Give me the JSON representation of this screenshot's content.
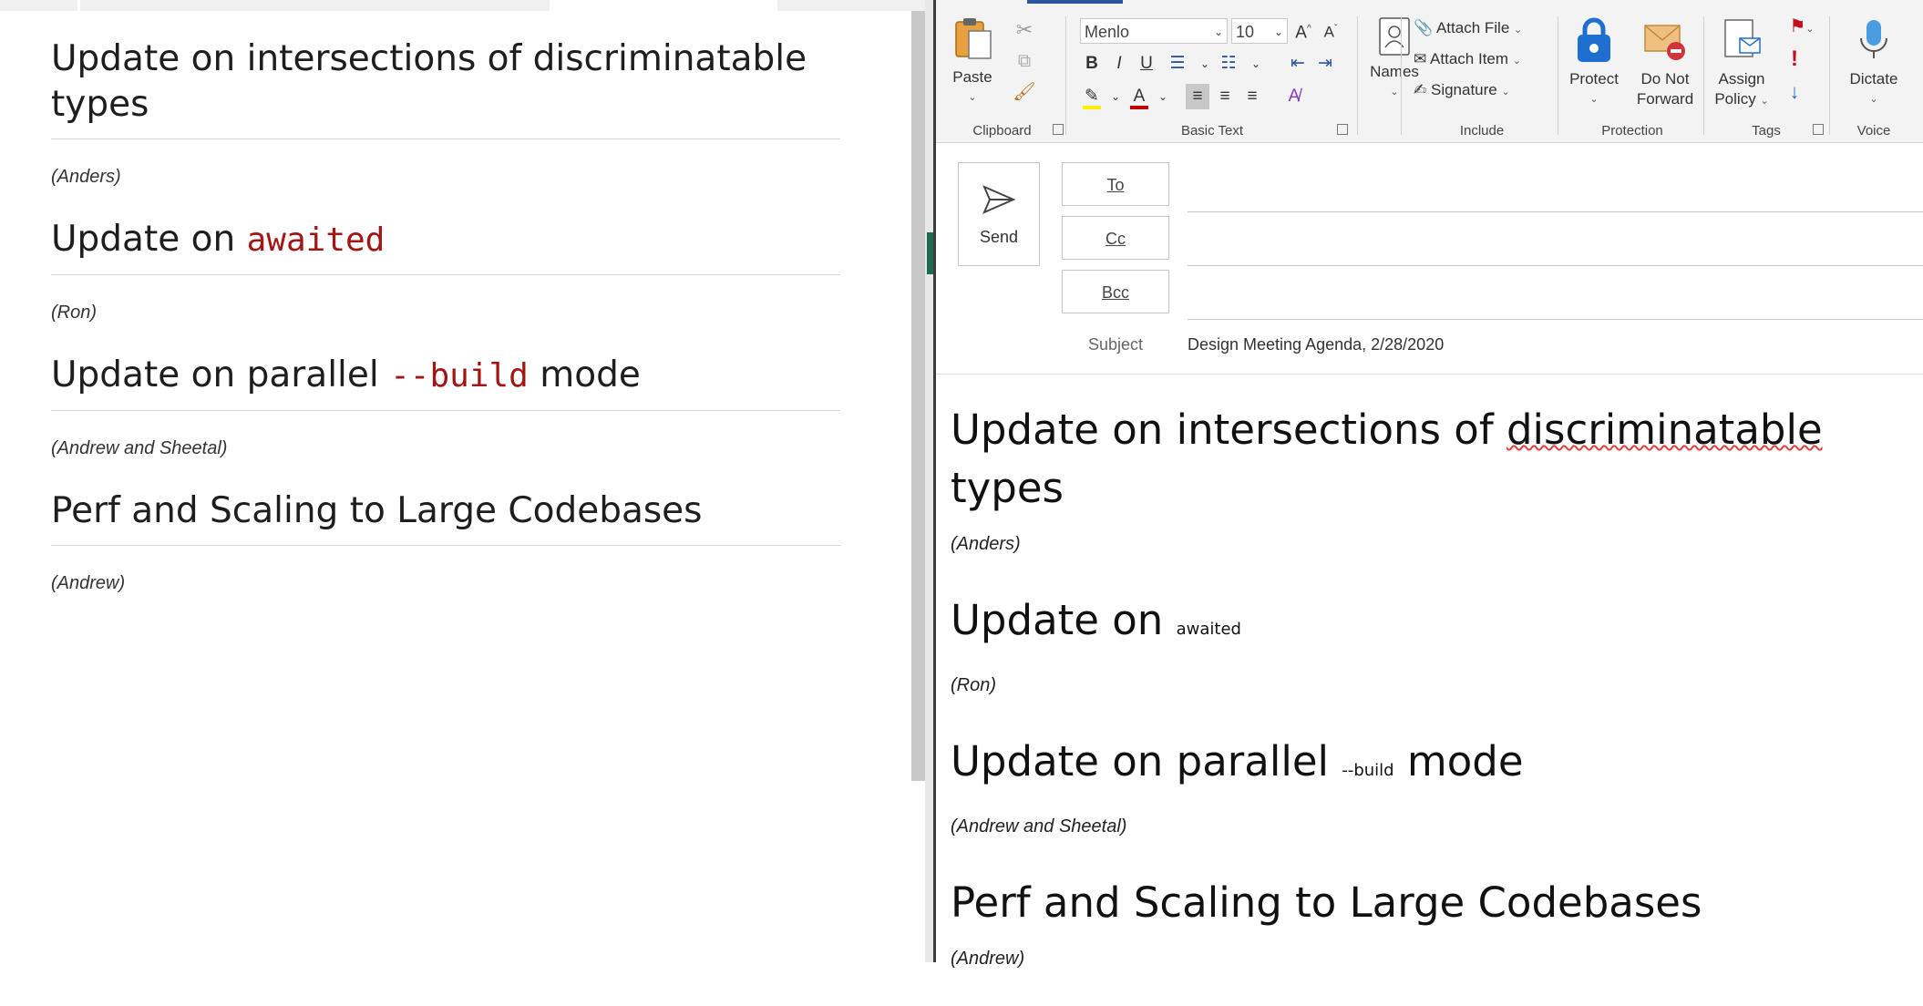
{
  "left_doc": {
    "sections": [
      {
        "heading_text": "Update on intersections of discriminatable types",
        "code": "",
        "heading_suffix": "",
        "byline": "(Anders)"
      },
      {
        "heading_text": "Update on ",
        "code": "awaited",
        "heading_suffix": "",
        "byline": "(Ron)"
      },
      {
        "heading_text": "Update on parallel ",
        "code": "--build",
        "heading_suffix": " mode",
        "byline": "(Andrew and Sheetal)"
      },
      {
        "heading_text": "Perf and Scaling to Large Codebases",
        "code": "",
        "heading_suffix": "",
        "byline": "(Andrew)"
      }
    ]
  },
  "ribbon": {
    "clipboard": {
      "paste": "Paste",
      "label": "Clipboard"
    },
    "basic_text": {
      "font": "Menlo",
      "size": "10",
      "label": "Basic Text"
    },
    "names": {
      "label": "Names"
    },
    "include": {
      "attach_file": "Attach File",
      "attach_item": "Attach Item",
      "signature": "Signature",
      "label": "Include"
    },
    "protection": {
      "protect": "Protect",
      "do_not_forward_1": "Do Not",
      "do_not_forward_2": "Forward",
      "label": "Protection"
    },
    "tags": {
      "assign_1": "Assign",
      "assign_2": "Policy",
      "label": "Tags"
    },
    "voice": {
      "dictate": "Dictate",
      "label": "Voice"
    }
  },
  "compose": {
    "send": "Send",
    "to": "To",
    "cc": "Cc",
    "bcc": "Bcc",
    "subject_label": "Subject",
    "subject": "Design Meeting Agenda, 2/28/2020"
  },
  "mail_body": {
    "s1_a": "Update on intersections of ",
    "s1_b": "discriminatable",
    "s1_c": " types",
    "s1_by": "(Anders)",
    "s2_a": "Update on ",
    "s2_code": "awaited",
    "s2_by": "(Ron)",
    "s3_a": "Update on parallel ",
    "s3_code": "--build",
    "s3_c": " mode",
    "s3_by": "(Andrew and Sheetal)",
    "s4_a": "Perf and Scaling to Large Codebases",
    "s4_by": "(Andrew)"
  },
  "colors": {
    "accent": "#2b579a",
    "code_red": "#a31515",
    "spell_red": "#e04040",
    "flag_red": "#c50f1f",
    "protect_blue": "#1f6fd1"
  }
}
